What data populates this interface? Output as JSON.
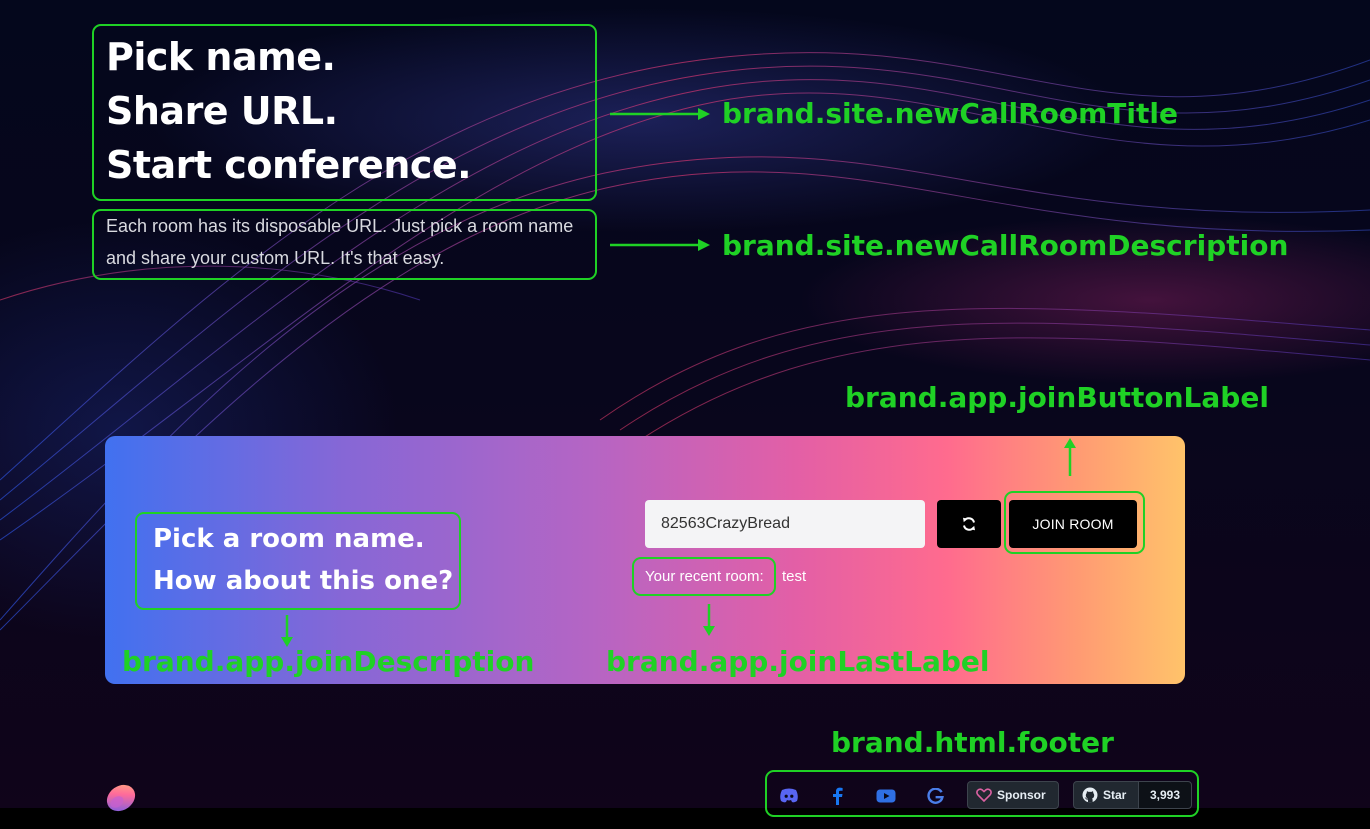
{
  "hero": {
    "title_lines": [
      "Pick name.",
      "Share URL.",
      "Start conference."
    ],
    "description": "Each room has its disposable URL. Just pick a room name and share your custom URL. It's that easy."
  },
  "join": {
    "description_lines": [
      "Pick a room name.",
      "How about this one?"
    ],
    "room_input_value": "82563CrazyBread",
    "refresh_icon": "refresh-icon",
    "join_button_label": "JOIN ROOM",
    "recent_label": "Your recent room:",
    "recent_room": "test"
  },
  "footer": {
    "icons": [
      "discord-icon",
      "facebook-icon",
      "youtube-icon",
      "google-icon"
    ],
    "sponsor_label": "Sponsor",
    "star_label": "Star",
    "star_count": "3,993"
  },
  "annotations": {
    "title_key": "brand.site.newCallRoomTitle",
    "description_key": "brand.site.newCallRoomDescription",
    "join_button_key": "brand.app.joinButtonLabel",
    "join_description_key": "brand.app.joinDescription",
    "join_last_key": "brand.app.joinLastLabel",
    "footer_key": "brand.html.footer"
  },
  "colors": {
    "annotation_green": "#1fd125",
    "button_black": "#000000",
    "card_gradient_start": "#4171f0",
    "card_gradient_end": "#ffc36a",
    "discord": "#5865f2",
    "facebook": "#1877f2",
    "youtube": "#2f6fe4",
    "google": "#4a7ee8",
    "sponsor_heart": "#db61a2"
  }
}
